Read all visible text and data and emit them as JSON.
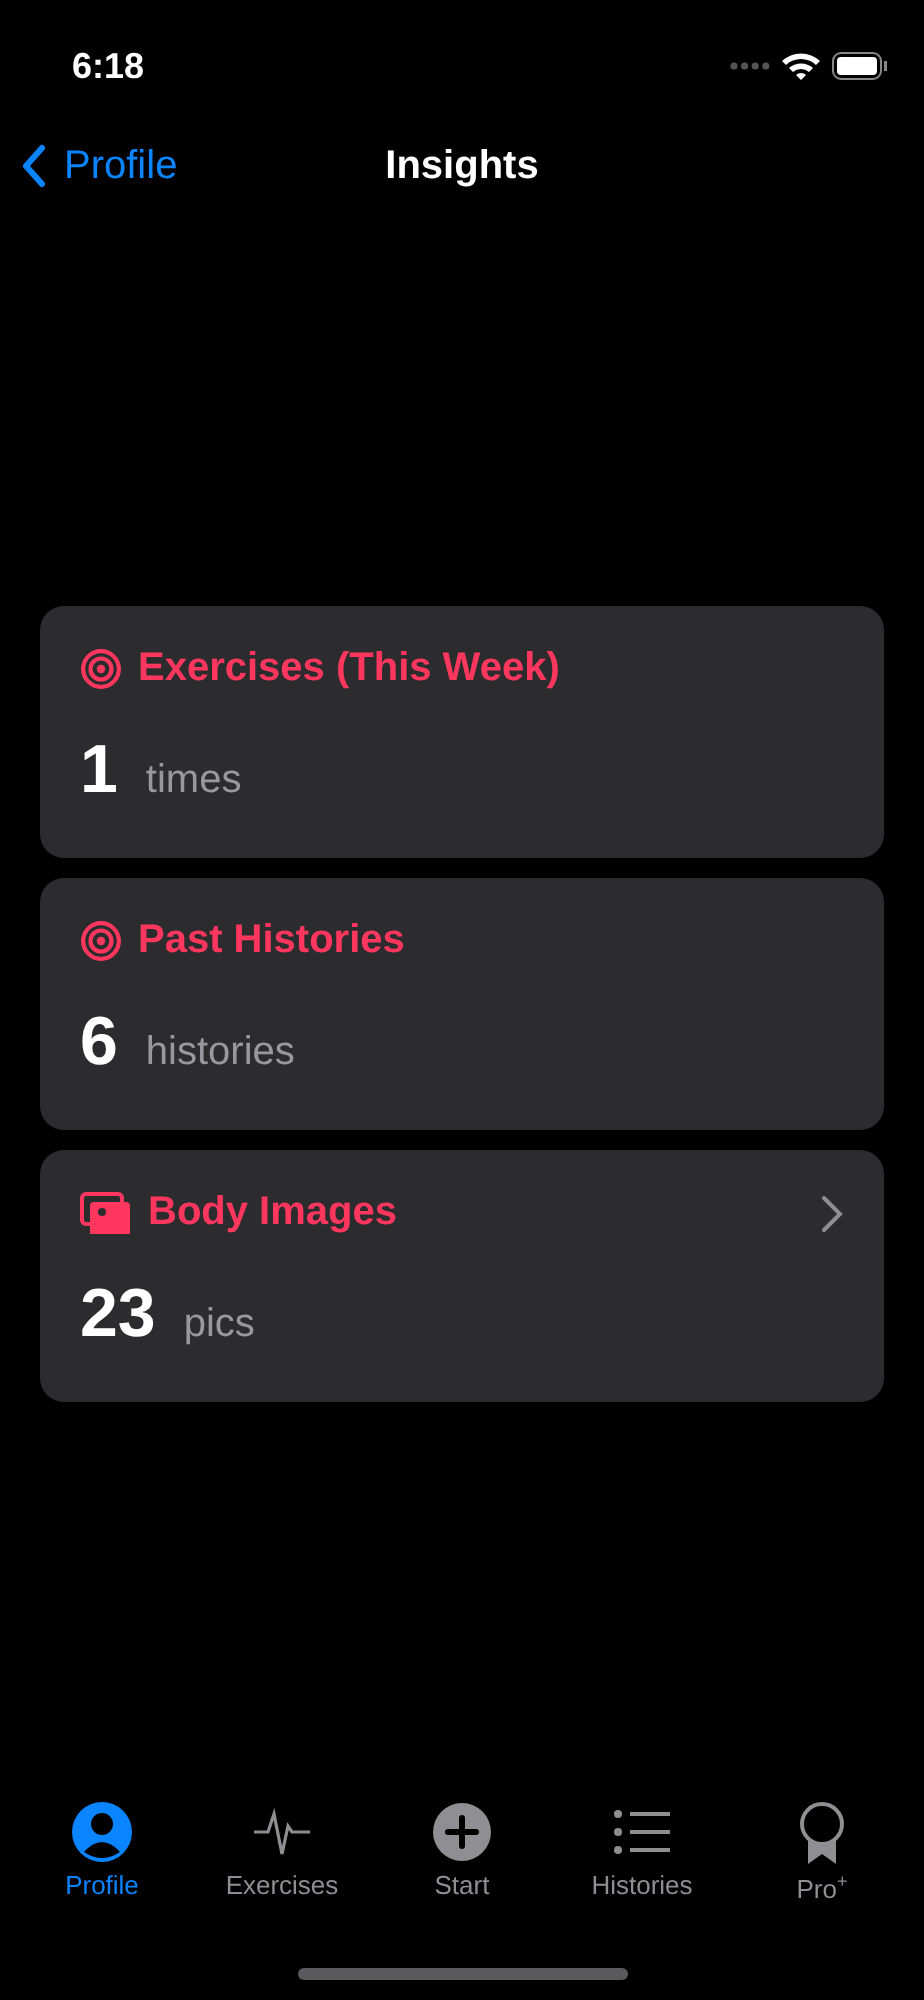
{
  "status_bar": {
    "time": "6:18"
  },
  "nav": {
    "back": "Profile",
    "title": "Insights"
  },
  "cards": [
    {
      "kind": "target",
      "title": "Exercises (This Week)",
      "value": "1",
      "unit": "times",
      "chevron": false
    },
    {
      "kind": "target",
      "title": "Past Histories",
      "value": "6",
      "unit": "histories",
      "chevron": false
    },
    {
      "kind": "images",
      "title": "Body Images",
      "value": "23",
      "unit": "pics",
      "chevron": true
    }
  ],
  "tab_bar": [
    {
      "kind": "person",
      "label": "Profile",
      "selected": true
    },
    {
      "kind": "pulse",
      "label": "Exercises",
      "selected": false
    },
    {
      "kind": "plus",
      "label": "Start",
      "selected": false
    },
    {
      "kind": "list",
      "label": "Histories",
      "selected": false
    },
    {
      "kind": "award",
      "label": "Pro$^{+}$",
      "selected": false
    }
  ]
}
